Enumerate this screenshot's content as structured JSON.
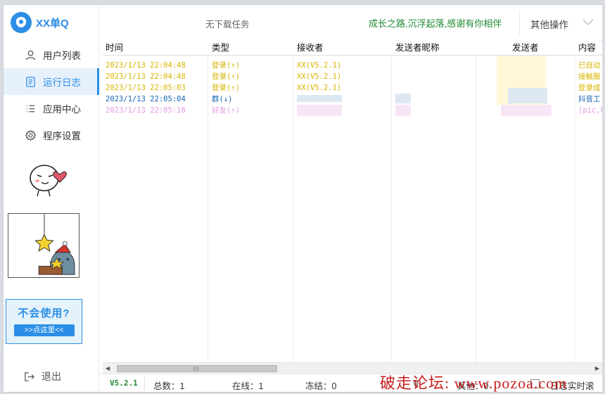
{
  "app": {
    "title": "XX单Q",
    "version": "V5.2.1"
  },
  "sidebar": {
    "items": [
      {
        "label": "用户列表",
        "icon": "user-icon"
      },
      {
        "label": "运行日志",
        "icon": "document-icon",
        "active": true
      },
      {
        "label": "应用中心",
        "icon": "list-icon"
      },
      {
        "label": "程序设置",
        "icon": "gear-icon"
      }
    ],
    "help_title": "不会使用?",
    "help_button": ">>点这里<<",
    "logout": "退出"
  },
  "header": {
    "no_task": "无下载任务",
    "slogan": "成长之路,沉浮起落,感谢有你相伴",
    "other_ops": "其他操作"
  },
  "table": {
    "columns": [
      "时间",
      "类型",
      "接收者",
      "发送者昵称",
      "发送者",
      "内容"
    ],
    "rows": [
      {
        "time": "2023/1/13 22:04:48",
        "type": "登录(↑)",
        "receiver": "XX(V5.2.1)",
        "content": "已自动",
        "color": "#d8b400"
      },
      {
        "time": "2023/1/13 22:04:48",
        "type": "登录(↑)",
        "receiver": "XX(V5.2.1)",
        "content": "接触服",
        "color": "#d8b400"
      },
      {
        "time": "2023/1/13 22:05:03",
        "type": "登录(↑)",
        "receiver": "XX(V5.2.1)",
        "content": "登录成",
        "color": "#d8b400"
      },
      {
        "time": "2023/1/13 22:05:04",
        "type": "群(↓)",
        "receiver": "",
        "content": "抖音工",
        "color": "#1565b5"
      },
      {
        "time": "2023/1/13 22:05:18",
        "type": "好友(↑)",
        "receiver": "",
        "content": "[pic,h",
        "color": "#e49ae4"
      }
    ]
  },
  "status": {
    "version": "V5.2.1",
    "total": "总数：1",
    "online": "在线：1",
    "frozen": "冻结：0",
    "other_hidden": "0",
    "other": "其他：0",
    "realtime_scroll": "日志实时滚动"
  },
  "watermark": "破走论坛: www.pozoa.com",
  "colors": {
    "accent": "#2b8ee6",
    "slogan": "#1f8a32",
    "login_row": "#d8b400",
    "group_row": "#1565b5",
    "friend_row": "#e49ae4"
  }
}
